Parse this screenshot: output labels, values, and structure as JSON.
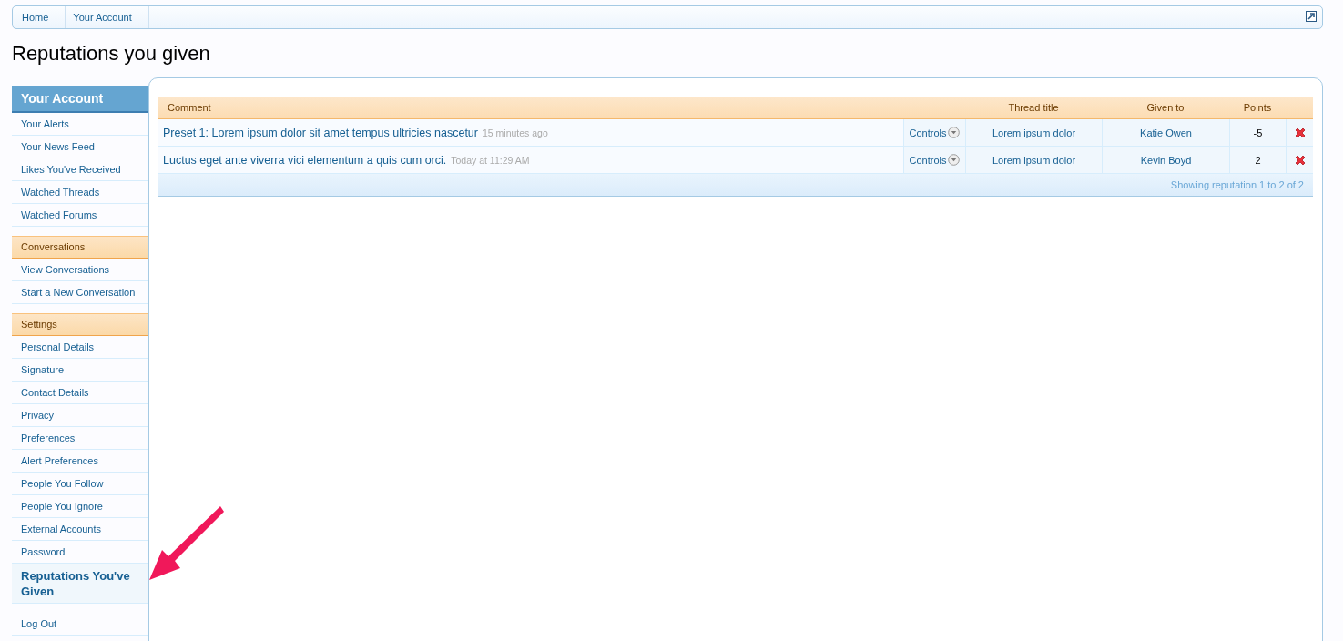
{
  "breadcrumb": [
    {
      "label": "Home"
    },
    {
      "label": "Your Account"
    }
  ],
  "page_title": "Reputations you given",
  "sidebar": {
    "title": "Your Account",
    "sections": [
      {
        "items": [
          {
            "label": "Your Alerts",
            "selected": false
          },
          {
            "label": "Your News Feed",
            "selected": false
          },
          {
            "label": "Likes You've Received",
            "selected": false
          },
          {
            "label": "Watched Threads",
            "selected": false
          },
          {
            "label": "Watched Forums",
            "selected": false
          }
        ]
      },
      {
        "heading": "Conversations",
        "items": [
          {
            "label": "View Conversations",
            "selected": false
          },
          {
            "label": "Start a New Conversation",
            "selected": false
          }
        ]
      },
      {
        "heading": "Settings",
        "items": [
          {
            "label": "Personal Details",
            "selected": false
          },
          {
            "label": "Signature",
            "selected": false
          },
          {
            "label": "Contact Details",
            "selected": false
          },
          {
            "label": "Privacy",
            "selected": false
          },
          {
            "label": "Preferences",
            "selected": false
          },
          {
            "label": "Alert Preferences",
            "selected": false
          },
          {
            "label": "People You Follow",
            "selected": false
          },
          {
            "label": "People You Ignore",
            "selected": false
          },
          {
            "label": "External Accounts",
            "selected": false
          },
          {
            "label": "Password",
            "selected": false
          },
          {
            "label": "Reputations You've Given",
            "selected": true
          }
        ]
      }
    ],
    "logout": "Log Out"
  },
  "table": {
    "columns": [
      "Comment",
      "Thread title",
      "Given to",
      "Points"
    ],
    "rows": [
      {
        "comment": "Preset 1: Lorem ipsum dolor sit amet tempus ultricies nascetur",
        "time": "15 minutes ago",
        "controls": "Controls",
        "thread": "Lorem ipsum dolor",
        "given_to": "Katie Owen",
        "points": "-5"
      },
      {
        "comment": "Luctus eget ante viverra vici elementum a quis cum orci.",
        "time": "Today at 11:29 AM",
        "controls": "Controls",
        "thread": "Lorem ipsum dolor",
        "given_to": "Kevin Boyd",
        "points": "2"
      }
    ],
    "footer": "Showing reputation 1 to 2 of 2"
  }
}
